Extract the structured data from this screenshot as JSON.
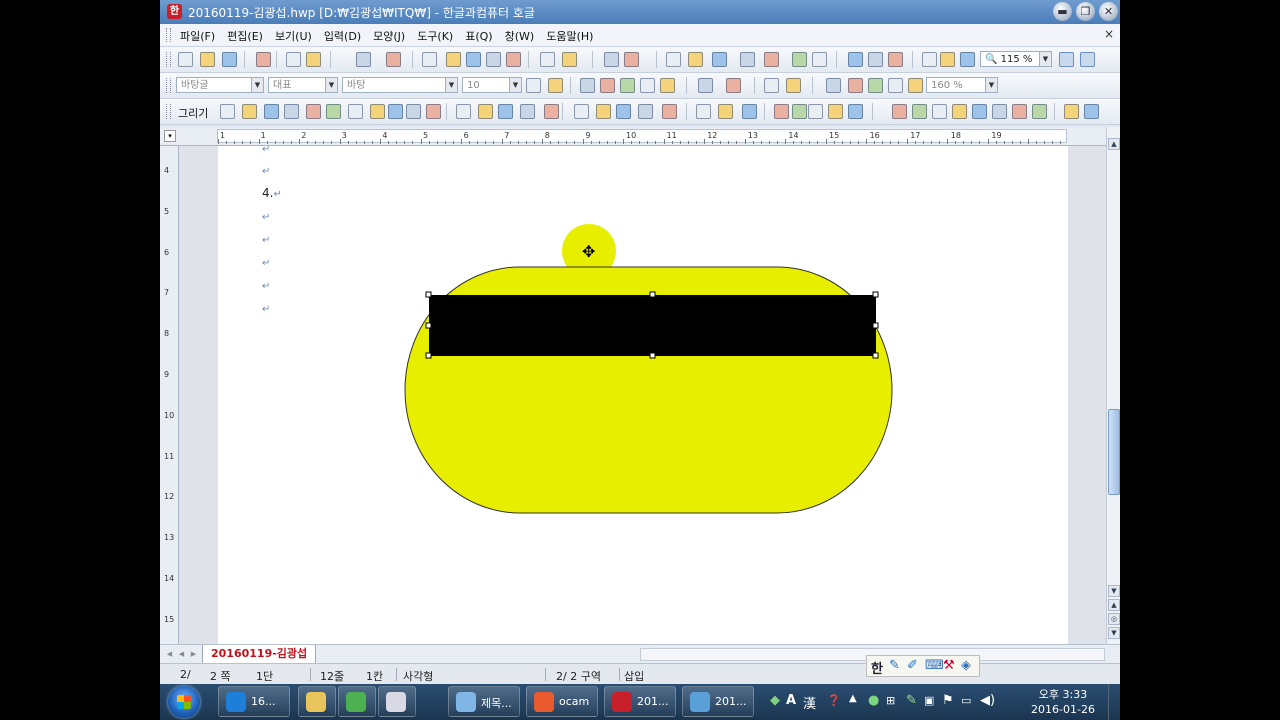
{
  "window": {
    "app_icon_glyph": "한",
    "title": "20160119-김광섭.hwp [D:₩김광섭₩ITQ₩] - 한글과컴퓨터 호글",
    "minimize": "▬",
    "restore": "❐",
    "close": "✕"
  },
  "menu": {
    "items": [
      "파일(F)",
      "편집(E)",
      "보기(U)",
      "입력(D)",
      "모양(J)",
      "도구(K)",
      "표(Q)",
      "창(W)",
      "도움말(H)"
    ],
    "close_glyph": "×"
  },
  "toolbar": {
    "zoom_value": "115 %",
    "style_combo": "바탕글",
    "outline_combo": "대표",
    "font_combo": "바탕",
    "size_combo": "10",
    "line_spacing_combo": "160 %",
    "draw_label": "그리기"
  },
  "ruler": {
    "h_numbers": [
      "1",
      "1",
      "2",
      "3",
      "4",
      "5",
      "6",
      "7",
      "8",
      "9",
      "10",
      "11",
      "12",
      "13",
      "14",
      "15",
      "16",
      "17",
      "18",
      "19"
    ],
    "v_numbers": [
      "4",
      "5",
      "6",
      "7",
      "8",
      "9",
      "10",
      "11",
      "12",
      "13",
      "14",
      "15"
    ]
  },
  "document": {
    "return_mark": "↵",
    "para_4": "4.",
    "move_cursor_glyph": "✥"
  },
  "tabs": {
    "active_tab": "20160119-김광섭"
  },
  "status": {
    "page": "2/",
    "page_count": "2 쪽",
    "column": "1단",
    "line": "12줄",
    "col": "1칸",
    "object": "사각형",
    "section": "2/ 2 구역",
    "mode": "삽입"
  },
  "ime": {
    "han": "한"
  },
  "taskbar": {
    "items": [
      {
        "label": "16...",
        "icon": "ie-icon",
        "color": "#1e7fd8"
      },
      {
        "label": "",
        "icon": "folder-icon",
        "color": "#e9c45b"
      },
      {
        "label": "",
        "icon": "chrome-icon",
        "color": "#4caf50"
      },
      {
        "label": "",
        "icon": "paint-icon",
        "color": "#d9d9e6"
      },
      {
        "label": "제목...",
        "icon": "notepad-icon",
        "color": "#7fb6e5"
      },
      {
        "label": "ocam",
        "icon": "ocam-icon",
        "color": "#e95b2e"
      },
      {
        "label": "201...",
        "icon": "hwp-icon",
        "color": "#c8202a"
      },
      {
        "label": "201...",
        "icon": "picture-icon",
        "color": "#5aa0d8"
      }
    ],
    "tray_a": "A",
    "tray_han": "漢",
    "clock_time": "오후 3:33",
    "clock_date": "2016-01-26"
  },
  "colors": {
    "ellipse_fill": "#e8ee00",
    "rect_fill": "#000000"
  }
}
